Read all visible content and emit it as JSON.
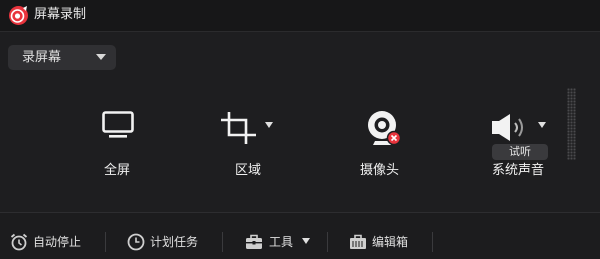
{
  "app": {
    "title": "屏幕录制"
  },
  "mode": {
    "selected": "录屏幕"
  },
  "options": {
    "fullscreen": "全屏",
    "region": "区域",
    "camera": "摄像头",
    "system_audio": "系统声音",
    "audition": "试听"
  },
  "bottom": {
    "auto_stop": "自动停止",
    "schedule": "计划任务",
    "tools": "工具",
    "editor": "编辑箱"
  },
  "colors": {
    "accent": "#e8343d",
    "background": "#1e1e20"
  },
  "icons": [
    "record-logo-icon",
    "monitor-icon",
    "crop-icon",
    "webcam-icon",
    "speaker-icon",
    "alarm-icon",
    "clock-icon",
    "toolbox-icon",
    "briefcase-icon"
  ]
}
